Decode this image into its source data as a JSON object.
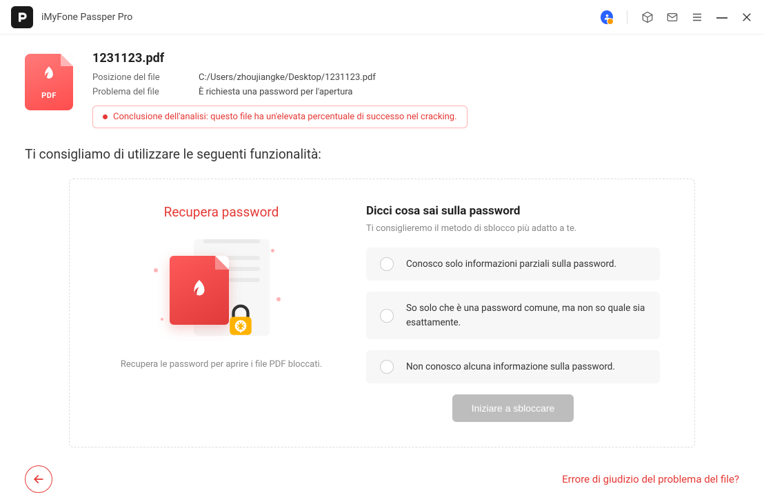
{
  "app": {
    "title": "iMyFone Passper Pro"
  },
  "file": {
    "name": "1231123.pdf",
    "position_label": "Posizione del file",
    "position_value": "C:/Users/zhoujiangke/Desktop/1231123.pdf",
    "problem_label": "Problema del file",
    "problem_value": "È richiesta una password per l'apertura",
    "analysis_text": "Conclusione dell'analisi: questo file ha un'elevata percentuale di successo nel cracking.",
    "badge_text": "PDF"
  },
  "recommend_heading": "Ti consigliamo di utilizzare le seguenti funzionalità:",
  "left_panel": {
    "title": "Recupera password",
    "description": "Recupera le password per aprire i file PDF bloccati."
  },
  "right_panel": {
    "title": "Dicci cosa sai sulla password",
    "subtitle": "Ti consiglieremo il metodo di sblocco più adatto a te.",
    "options": [
      "Conosco solo informazioni parziali sulla password.",
      "So solo che è una password comune, ma non so quale sia esattamente.",
      "Non conosco alcuna informazione sulla password."
    ],
    "start_button": "Iniziare a sbloccare"
  },
  "footer": {
    "error_link": "Errore di giudizio del problema del file?"
  }
}
